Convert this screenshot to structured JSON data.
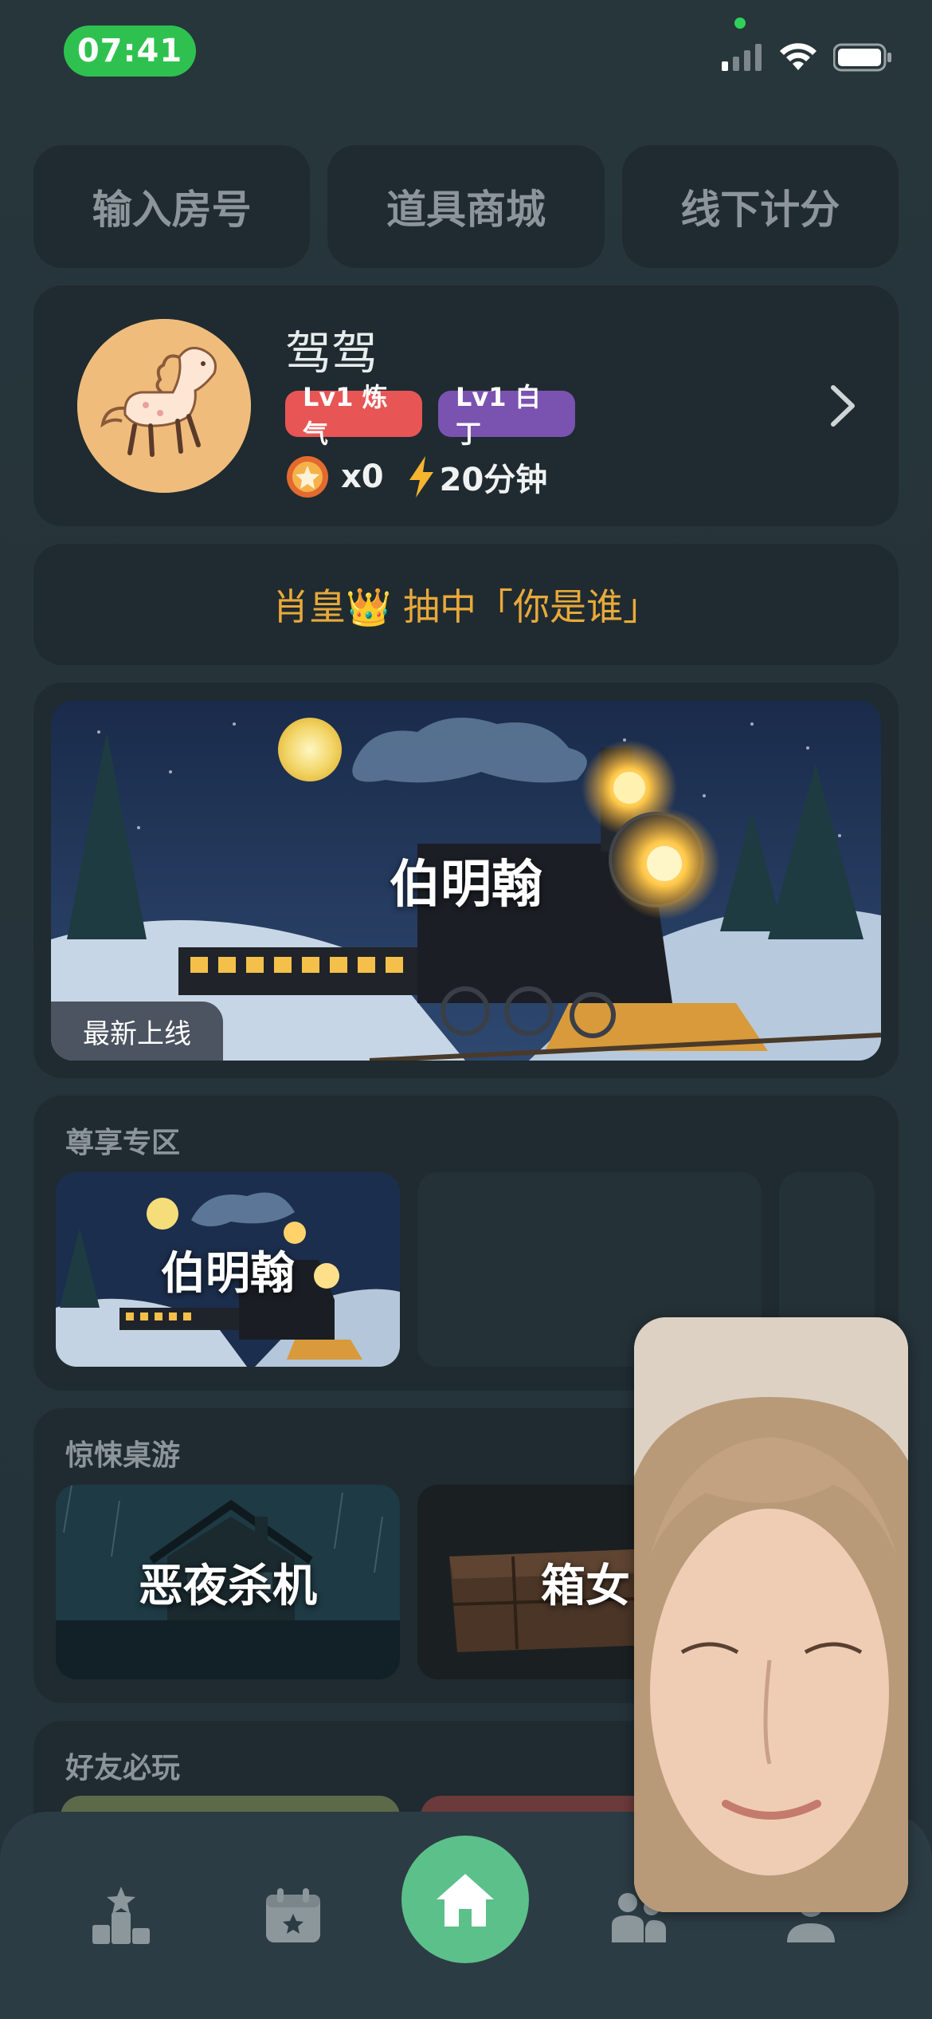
{
  "status_bar": {
    "time": "07:41"
  },
  "top_buttons": [
    {
      "label": "输入房号"
    },
    {
      "label": "道具商城"
    },
    {
      "label": "线下计分"
    }
  ],
  "profile": {
    "name": "驾驾",
    "badges": [
      "Lv1 炼气",
      "Lv1 白丁"
    ],
    "coins": "x0",
    "energy": "20分钟"
  },
  "announcement": {
    "text": "肖皇👑 抽中「你是谁」"
  },
  "banner": {
    "title": "伯明翰",
    "tag": "最新上线"
  },
  "sections": [
    {
      "title": "尊享专区",
      "cards": [
        "伯明翰",
        "",
        ""
      ]
    },
    {
      "title": "惊悚桌游",
      "cards": [
        "恶夜杀机",
        "箱女"
      ]
    },
    {
      "title": "好友必玩",
      "cards": [
        "",
        ""
      ]
    }
  ],
  "colors": {
    "accent_green": "#5cc08a",
    "announcement": "#e9a93a",
    "badge_red": "#e85555",
    "badge_purple": "#7a52b0"
  },
  "icons": [
    "ranking-icon",
    "calendar-icon",
    "home-icon",
    "friends-icon",
    "profile-icon"
  ]
}
